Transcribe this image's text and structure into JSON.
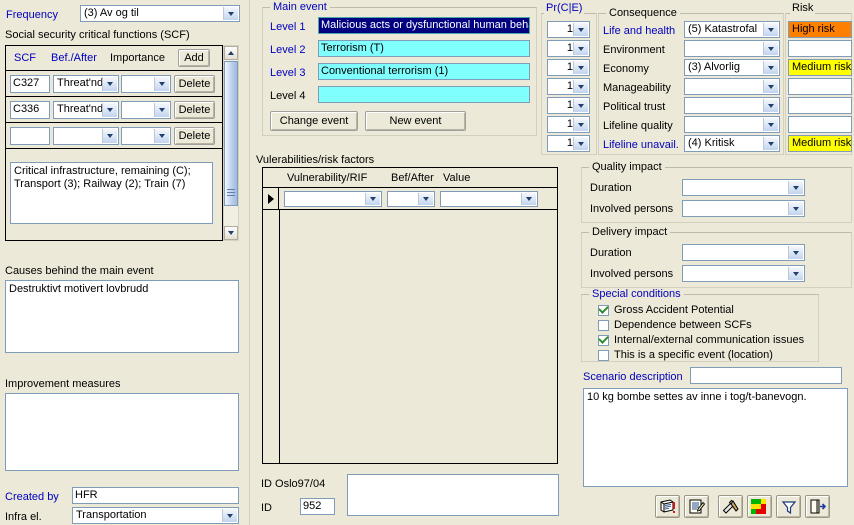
{
  "colors": {
    "window_bg": "#ece9d8",
    "field_bg": "#ffffff",
    "cyan_field": "#80ffff",
    "high_risk": "#ff8000",
    "medium_risk": "#ffff00",
    "label_blue": "#0000c0",
    "selection_navy": "#000080"
  },
  "left_panel": {
    "frequency_label": "Frequency",
    "frequency_value": "(3) Av og til",
    "scf_section_label": "Social security critical functions (SCF)",
    "scf_columns": [
      "SCF",
      "Bef./After",
      "Importance"
    ],
    "add_button": "Add",
    "scf_rows": [
      {
        "scf": "C327",
        "bef_after": "Threat'nd",
        "importance": "",
        "delete_label": "Delete"
      },
      {
        "scf": "C336",
        "bef_after": "Threat'nd",
        "importance": "",
        "delete_label": "Delete"
      },
      {
        "scf": "",
        "bef_after": "",
        "importance": "",
        "delete_label": "Delete"
      }
    ],
    "scf_description": "Critical infrastructure, remaining (C);\nTransport (3); Railway (2); Train (7)",
    "causes_label": "Causes behind the main event",
    "causes_value": "Destruktivt motivert lovbrudd",
    "improvement_label": "Improvement measures",
    "improvement_value": "",
    "created_by_label": "Created by",
    "created_by_value": "HFR",
    "infra_el_label": "Infra el.",
    "infra_el_value": "Transportation"
  },
  "main_event": {
    "caption": "Main event",
    "levels": [
      {
        "label": "Level 1",
        "value": "Malicious acts or dysfunctional human behav",
        "selected": true
      },
      {
        "label": "Level 2",
        "value": "Terrorism (T)",
        "selected": false
      },
      {
        "label": "Level 3",
        "value": "Conventional terrorism (1)",
        "selected": false
      },
      {
        "label": "Level 4",
        "value": "",
        "selected": false
      }
    ],
    "change_event_button": "Change event",
    "new_event_button": "New event"
  },
  "vulnerabilities": {
    "caption": "Vulerabilities/risk factors",
    "columns": [
      "Vulnerability/RIF",
      "Bef/After",
      "Value"
    ],
    "rows": [
      {
        "vulnerability": "",
        "bef_after": "",
        "value": ""
      }
    ]
  },
  "pr_cie": {
    "caption": "Pr(C|E)",
    "values": [
      "1",
      "1",
      "1",
      "1",
      "1",
      "1",
      "1"
    ]
  },
  "consequence": {
    "caption": "Consequence",
    "rows": [
      {
        "label": "Life and health",
        "label_blue": true,
        "value": "(5) Katastrofal",
        "risk": "High risk",
        "risk_level": "high"
      },
      {
        "label": "Environment",
        "label_blue": false,
        "value": "",
        "risk": "",
        "risk_level": "none"
      },
      {
        "label": "Economy",
        "label_blue": false,
        "value": "(3) Alvorlig",
        "risk": "Medium risk",
        "risk_level": "medium"
      },
      {
        "label": "Manageability",
        "label_blue": false,
        "value": "",
        "risk": "",
        "risk_level": "none"
      },
      {
        "label": "Political trust",
        "label_blue": false,
        "value": "",
        "risk": "",
        "risk_level": "none"
      },
      {
        "label": "Lifeline quality",
        "label_blue": false,
        "value": "",
        "risk": "",
        "risk_level": "none"
      },
      {
        "label": "Lifeline unavail.",
        "label_blue": true,
        "value": "(4) Kritisk",
        "risk": "Medium risk",
        "risk_level": "medium"
      }
    ]
  },
  "risk": {
    "caption": "Risk"
  },
  "quality_impact": {
    "caption": "Quality impact",
    "duration_label": "Duration",
    "duration_value": "",
    "involved_label": "Involved persons",
    "involved_value": ""
  },
  "delivery_impact": {
    "caption": "Delivery impact",
    "duration_label": "Duration",
    "duration_value": "",
    "involved_label": "Involved persons",
    "involved_value": ""
  },
  "special_conditions": {
    "caption": "Special conditions",
    "items": [
      {
        "label": "Gross Accident Potential",
        "checked": true
      },
      {
        "label": "Dependence between SCFs",
        "checked": false
      },
      {
        "label": "Internal/external communication issues",
        "checked": true
      },
      {
        "label": "This is a specific event (location)",
        "checked": false
      }
    ]
  },
  "scenario": {
    "label": "Scenario description",
    "title_value": "",
    "text_value": "10 kg bombe settes av inne i tog/t-banevogn."
  },
  "footer_ids": {
    "id_oslo_label": "ID Oslo97/04",
    "id_label": "ID",
    "id_value": "952",
    "notes_value": ""
  },
  "toolbar": {
    "buttons": [
      {
        "name": "print-report-icon",
        "tip": "Print report"
      },
      {
        "name": "edit-document-icon",
        "tip": "Edit document"
      },
      {
        "name": "tools-icon",
        "tip": "Tools"
      },
      {
        "name": "risk-matrix-icon",
        "tip": "Risk matrix"
      },
      {
        "name": "filter-icon",
        "tip": "Filter"
      },
      {
        "name": "exit-icon",
        "tip": "Exit"
      }
    ]
  }
}
